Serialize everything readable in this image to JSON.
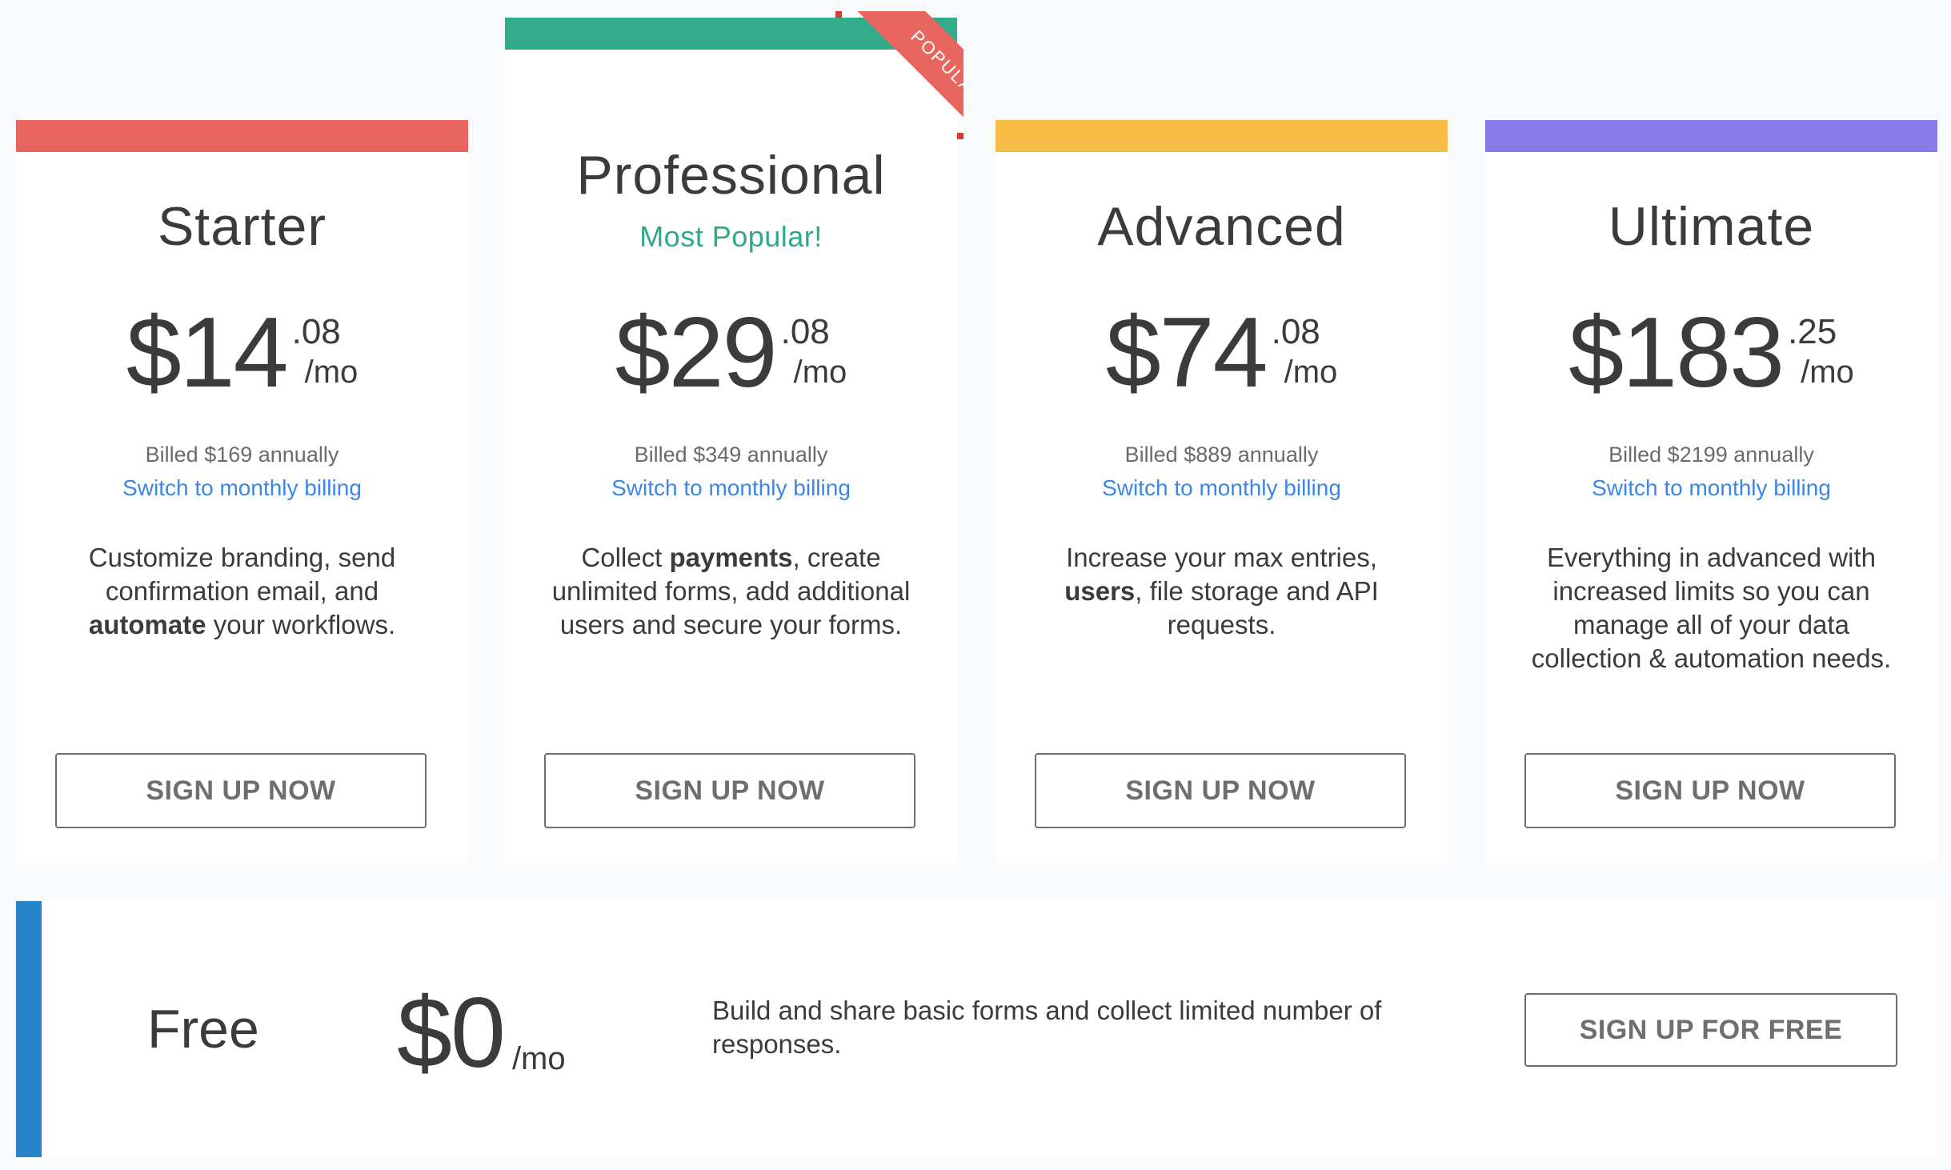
{
  "colors": {
    "starter": "#e8665f",
    "professional": "#32ab8b",
    "advanced": "#f6bc45",
    "ultimate": "#897ce8",
    "free": "#2985c9",
    "link": "#3b86e6",
    "popular_text": "#2ea986"
  },
  "plans": [
    {
      "name": "Starter",
      "price_whole": "$14",
      "price_cents": ".08",
      "period": "/mo",
      "billed": "Billed $169 annually",
      "switch_link": "Switch to monthly billing",
      "description": [
        {
          "text": "Customize branding, send confirmation email, and ",
          "bold": false
        },
        {
          "text": "automate",
          "bold": true
        },
        {
          "text": " your workflows.",
          "bold": false
        }
      ],
      "cta": "SIGN UP NOW"
    },
    {
      "name": "Professional",
      "subtitle": "Most Popular!",
      "ribbon": "POPULAR",
      "price_whole": "$29",
      "price_cents": ".08",
      "period": "/mo",
      "billed": "Billed $349 annually",
      "switch_link": "Switch to monthly billing",
      "description": [
        {
          "text": "Collect ",
          "bold": false
        },
        {
          "text": "payments",
          "bold": true
        },
        {
          "text": ", create unlimited forms, add additional users and secure your forms.",
          "bold": false
        }
      ],
      "cta": "SIGN UP NOW"
    },
    {
      "name": "Advanced",
      "price_whole": "$74",
      "price_cents": ".08",
      "period": "/mo",
      "billed": "Billed $889 annually",
      "switch_link": "Switch to monthly billing",
      "description": [
        {
          "text": "Increase your max entries, ",
          "bold": false
        },
        {
          "text": "users",
          "bold": true
        },
        {
          "text": ", file storage and API requests.",
          "bold": false
        }
      ],
      "cta": "SIGN UP NOW"
    },
    {
      "name": "Ultimate",
      "price_whole": "$183",
      "price_cents": ".25",
      "period": "/mo",
      "billed": "Billed $2199 annually",
      "switch_link": "Switch to monthly billing",
      "description": [
        {
          "text": "Everything in advanced with increased limits so you can manage all of your data collection & automation needs.",
          "bold": false
        }
      ],
      "cta": "SIGN UP NOW"
    }
  ],
  "free_plan": {
    "name": "Free",
    "price": "$0",
    "period": "/mo",
    "description": "Build and share basic forms and collect limited number of responses.",
    "cta": "SIGN UP FOR FREE"
  }
}
